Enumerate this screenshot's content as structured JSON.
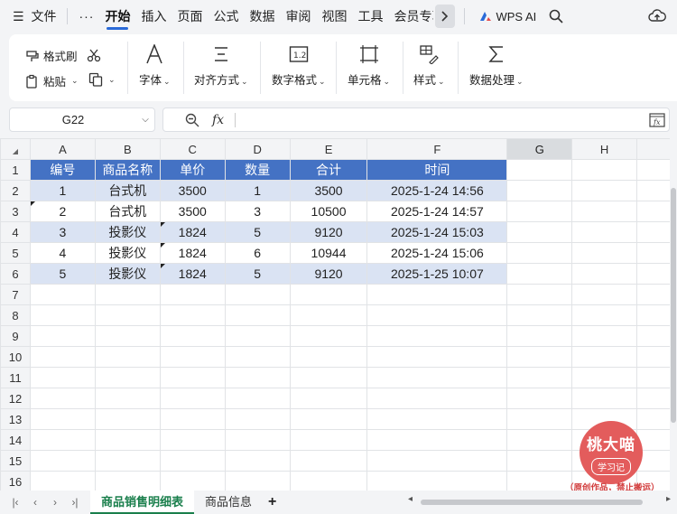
{
  "menubar": {
    "hamburger_label": "文件",
    "more_label": "···",
    "tabs": [
      "开始",
      "插入",
      "页面",
      "公式",
      "数据",
      "审阅",
      "视图",
      "工具",
      "会员专享"
    ],
    "active_tab": "开始",
    "wps_ai_label": "WPS AI"
  },
  "ribbon": {
    "format_painter": "格式刷",
    "paste": "粘贴",
    "font": "字体",
    "align": "对齐方式",
    "number_format": "数字格式",
    "cell": "单元格",
    "style": "样式",
    "data_process": "数据处理"
  },
  "formula_bar": {
    "name_box": "G22",
    "fx_label": "fx",
    "formula": ""
  },
  "columns": [
    "A",
    "B",
    "C",
    "D",
    "E",
    "F",
    "G",
    "H"
  ],
  "selected_column": "G",
  "rows": [
    "1",
    "2",
    "3",
    "4",
    "5",
    "6",
    "7",
    "8",
    "9",
    "10",
    "11",
    "12",
    "13",
    "14",
    "15",
    "16"
  ],
  "table": {
    "headers": [
      "编号",
      "商品名称",
      "单价",
      "数量",
      "合计",
      "时间"
    ],
    "rows": [
      [
        "1",
        "台式机",
        "3500",
        "1",
        "3500",
        "2025-1-24 14:56"
      ],
      [
        "2",
        "台式机",
        "3500",
        "3",
        "10500",
        "2025-1-24 14:57"
      ],
      [
        "3",
        "投影仪",
        "1824",
        "5",
        "9120",
        "2025-1-24 15:03"
      ],
      [
        "4",
        "投影仪",
        "1824",
        "6",
        "10944",
        "2025-1-24 15:06"
      ],
      [
        "5",
        "投影仪",
        "1824",
        "5",
        "9120",
        "2025-1-25 10:07"
      ]
    ]
  },
  "sheet_tabs": {
    "active": "商品销售明细表",
    "other": "商品信息",
    "add": "+"
  },
  "watermark": {
    "title": "桃大喵",
    "subtitle": "学习记",
    "note": "（原创作品，禁止搬运）"
  },
  "colors": {
    "header_bg": "#4472c4",
    "band_bg": "#dae3f3",
    "accent": "#2a6ad8",
    "sheet_tab_active": "#1a7f4c",
    "watermark": "#e35c5c"
  }
}
